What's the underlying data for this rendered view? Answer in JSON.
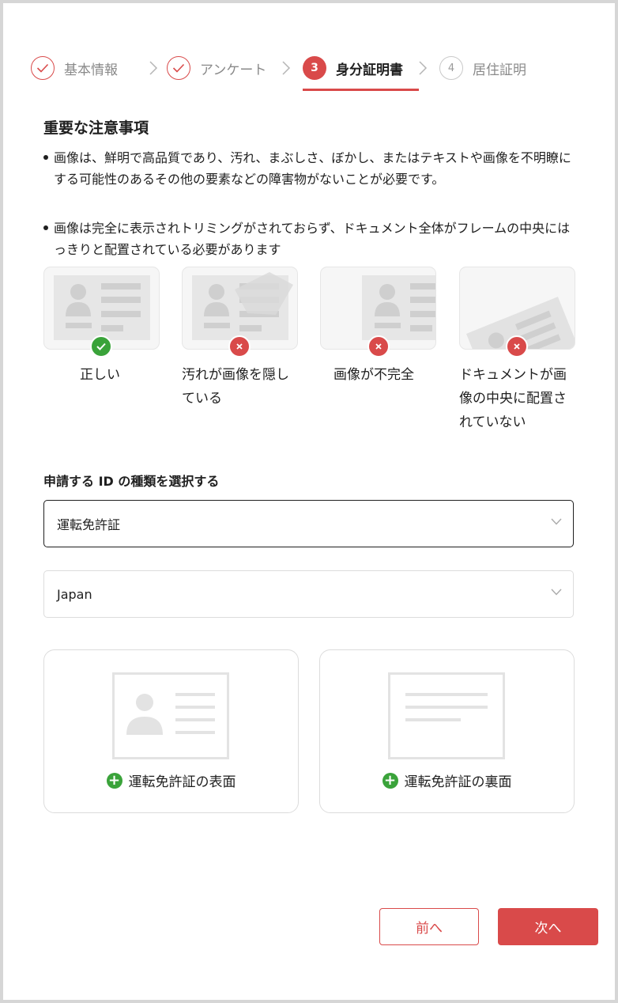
{
  "stepper": {
    "steps": [
      {
        "number": "1",
        "label": "基本情報",
        "status": "done"
      },
      {
        "number": "2",
        "label": "アンケート",
        "status": "done"
      },
      {
        "number": "3",
        "label": "身分証明書",
        "status": "active"
      },
      {
        "number": "4",
        "label": "居住証明",
        "status": "pending"
      }
    ]
  },
  "notice": {
    "title": "重要な注意事項",
    "bullets": [
      "画像は、鮮明で高品質であり、汚れ、まぶしさ、ぼかし、またはテキストや画像を不明瞭にする可能性のあるその他の要素などの障害物がないことが必要です。",
      "画像は完全に表示されトリミングがされておらず、ドキュメント全体がフレームの中央にはっきりと配置されている必要があります"
    ]
  },
  "examples": [
    {
      "caption": "正しい",
      "status": "ok"
    },
    {
      "caption": "汚れが画像を隠している",
      "status": "ng"
    },
    {
      "caption": "画像が不完全",
      "status": "ng"
    },
    {
      "caption": "ドキュメントが画像の中央に配置されていない",
      "status": "ng"
    }
  ],
  "id_select": {
    "title": "申請する ID の種類を選択する",
    "document_type": "運転免許証",
    "country": "Japan"
  },
  "upload": {
    "front_label": "運転免許証の表面",
    "back_label": "運転免許証の裏面"
  },
  "buttons": {
    "prev": "前へ",
    "next": "次へ"
  },
  "colors": {
    "accent": "#d94a4a",
    "success": "#3aa33a",
    "error": "#d94a4a"
  }
}
